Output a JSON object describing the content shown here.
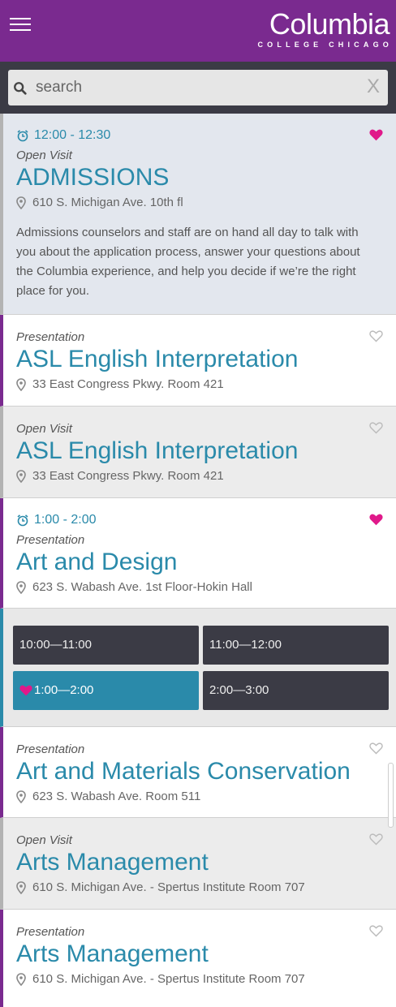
{
  "header": {
    "logo_main": "Columbia",
    "logo_sub": "COLLEGE CHICAGO",
    "menu_icon": "hamburger-icon",
    "bg_color": "#7a2a8f"
  },
  "search": {
    "placeholder": "search",
    "clear_label": "X",
    "icon": "search-icon"
  },
  "events": [
    {
      "time": "12:00 - 12:30",
      "type": "Open Visit",
      "title": "ADMISSIONS",
      "location": "610 S. Michigan Ave. 10th fl",
      "description": "Admissions counselors and staff are on hand all day to talk with you about the application process, answer your questions about the Columbia experience, and help you decide if we’re the right place for you.",
      "favorited": true
    },
    {
      "type": "Presentation",
      "title": "ASL English Interpretation",
      "location": "33 East Congress Pkwy. Room 421",
      "favorited": false
    },
    {
      "type": "Open Visit",
      "title": "ASL English Interpretation",
      "location": "33 East Congress Pkwy. Room 421",
      "favorited": false
    },
    {
      "time": "1:00 - 2:00",
      "type": "Presentation",
      "title": "Art and Design",
      "location": "623 S. Wabash Ave. 1st Floor-Hokin Hall",
      "favorited": true
    },
    {
      "type": "Presentation",
      "title": "Art and Materials Conservation",
      "location": "623 S. Wabash Ave. Room 511",
      "favorited": false
    },
    {
      "type": "Open Visit",
      "title": "Arts Management",
      "location": "610 S. Michigan Ave. - Spertus Institute Room 707",
      "favorited": false
    },
    {
      "type": "Presentation",
      "title": "Arts Management",
      "location": "610 S. Michigan Ave. - Spertus Institute Room 707",
      "favorited": false
    }
  ],
  "time_slots": [
    {
      "label": "10:00—11:00",
      "selected": false
    },
    {
      "label": "11:00—12:00",
      "selected": false
    },
    {
      "label": "1:00—2:00",
      "selected": true
    },
    {
      "label": "2:00—3:00",
      "selected": false
    }
  ],
  "colors": {
    "accent": "#2a8aaa",
    "brand": "#7a2a8f",
    "heart": "#e0198a",
    "dark": "#3b3b45"
  }
}
